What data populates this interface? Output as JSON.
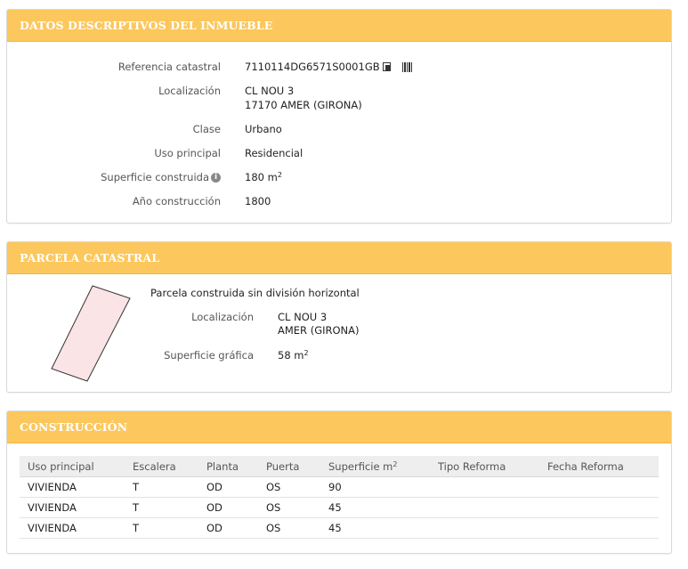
{
  "datos": {
    "title": "DATOS DESCRIPTIVOS DEL INMUEBLE",
    "ref_label": "Referencia catastral",
    "ref_value": "7110114DG6571S0001GB",
    "loc_label": "Localización",
    "loc_line1": "CL NOU 3",
    "loc_line2": "17170 AMER (GIRONA)",
    "clase_label": "Clase",
    "clase_value": "Urbano",
    "uso_label": "Uso principal",
    "uso_value": "Residencial",
    "sup_label": "Superficie construida",
    "sup_value": "180 m",
    "sup_unit_exp": "2",
    "anio_label": "Año construcción",
    "anio_value": "1800"
  },
  "parcela": {
    "title": "PARCELA CATASTRAL",
    "description": "Parcela construida sin división horizontal",
    "loc_label": "Localización",
    "loc_line1": "CL NOU 3",
    "loc_line2": "AMER (GIRONA)",
    "sup_label": "Superficie gráfica",
    "sup_value": "58 m",
    "sup_unit_exp": "2",
    "shape_fill": "#fbe4e6",
    "shape_stroke": "#333333"
  },
  "construccion": {
    "title": "CONSTRUCCIÓN",
    "headers": [
      "Uso principal",
      "Escalera",
      "Planta",
      "Puerta",
      "Superficie m",
      "Tipo Reforma",
      "Fecha Reforma"
    ],
    "header_sup_exp": "2",
    "rows": [
      [
        "VIVIENDA",
        "T",
        "OD",
        "OS",
        "90",
        "",
        ""
      ],
      [
        "VIVIENDA",
        "T",
        "OD",
        "OS",
        "45",
        "",
        ""
      ],
      [
        "VIVIENDA",
        "T",
        "OD",
        "OS",
        "45",
        "",
        ""
      ]
    ]
  },
  "icons": {
    "copy": "copy-icon",
    "barcode": "barcode-icon",
    "info": "info-icon"
  },
  "colors": {
    "header_bg": "#fcc75c",
    "header_text": "#ffffff"
  }
}
